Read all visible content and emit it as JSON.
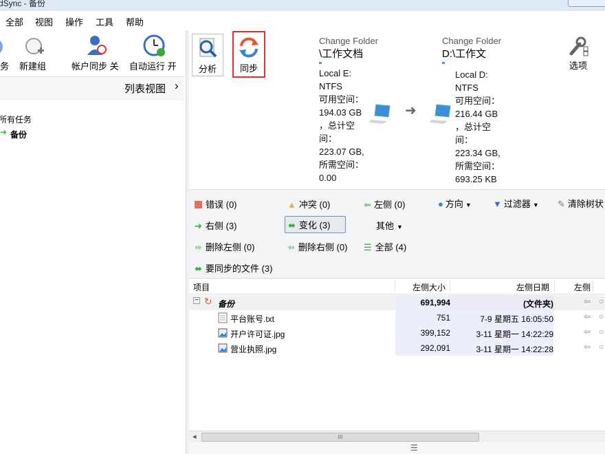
{
  "window": {
    "title": "dSync - 备份"
  },
  "menu": {
    "items": [
      "全部",
      "视图",
      "操作",
      "工具",
      "帮助"
    ]
  },
  "left_toolbar": {
    "task_label": "务",
    "new_group_label": "新建组",
    "account_sync_label": "帐户同步 关",
    "auto_run_label": "自动运行 开"
  },
  "list_view": {
    "label": "列表视图",
    "chevron": "›"
  },
  "tree": {
    "all_tasks": "所有任务",
    "backup": "备份"
  },
  "actions": {
    "analyze_label": "分析",
    "sync_label": "同步",
    "options_label": "选项"
  },
  "source": {
    "header": "Change Folder",
    "path": "\\工作文档",
    "lines": [
      "Local E:",
      "NTFS",
      "可用空间：",
      "194.03 GB",
      "，总计空",
      "间：",
      "223.07 GB,",
      "所需空间：",
      "0.00"
    ]
  },
  "target": {
    "header": "Change Folder",
    "path": "D:\\工作文",
    "lines": [
      "Local D:",
      "NTFS",
      "可用空间：",
      "216.44 GB",
      "，总计空",
      "间：",
      "223.34 GB,",
      "所需空间：",
      "693.25 KB"
    ]
  },
  "filters": {
    "errors": "错误 (0)",
    "conflicts": "冲突 (0)",
    "left": "左侧 (0)",
    "direction": "方向",
    "filter": "过滤器",
    "clear_tree": "清除树状",
    "right": "右侧 (3)",
    "changes": "变化 (3)",
    "other": "其他",
    "delete_left": "删除左侧 (0)",
    "delete_right": "删除右侧 (0)",
    "all": "全部 (4)",
    "to_sync": "要同步的文件 (3)"
  },
  "grid": {
    "columns": {
      "item": "项目",
      "left_size": "左侧大小",
      "left_date": "左侧日期",
      "left": "左侧"
    },
    "folder": {
      "name": "备份",
      "size": "691,994",
      "date": "(文件夹)"
    },
    "rows": [
      {
        "name": "平台账号.txt",
        "size": "751",
        "date": "7-9 星期五 16:05:50"
      },
      {
        "name": "开户许可证.jpg",
        "size": "399,152",
        "date": "3-11 星期一 14:22:29"
      },
      {
        "name": "营业执照.jpg",
        "size": "292,091",
        "date": "3-11 星期一 14:22:28"
      }
    ]
  },
  "scrollbar": {
    "left_arrow": "◂",
    "thumb_grip": "III"
  },
  "colors": {
    "accent_red": "#e03030",
    "green": "#3aa83a",
    "highlight": "#eceefc"
  }
}
